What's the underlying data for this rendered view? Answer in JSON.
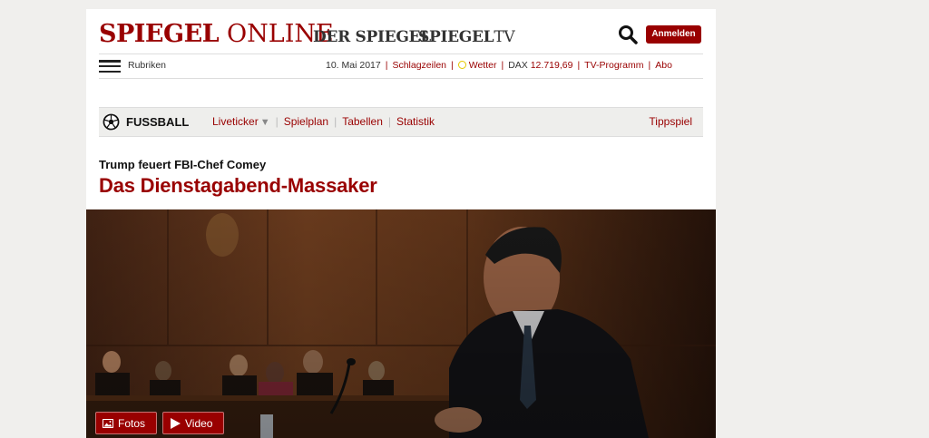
{
  "header": {
    "logo_spiegel": "SPIEGEL",
    "logo_online": "ONLINE",
    "logo_der_spiegel": "DER SPIEGEL",
    "logo_spiegel_tv_main": "SPIEGEL",
    "logo_spiegel_tv_suffix": "TV",
    "login_label": "Anmelden"
  },
  "nav": {
    "rubriken_label": "Rubriken",
    "date": "10. Mai 2017",
    "schlagzeilen": "Schlagzeilen",
    "wetter": "Wetter",
    "dax_label": "DAX",
    "dax_value": "12.719,69",
    "tv_programm": "TV-Programm",
    "abo": "Abo"
  },
  "section": {
    "title": "FUSSBALL",
    "items": [
      "Liveticker",
      "Spielplan",
      "Tabellen",
      "Statistik"
    ],
    "right_link": "Tippspiel"
  },
  "article": {
    "kicker": "Trump feuert FBI-Chef Comey",
    "headline": "Das Dienstagabend-Massaker"
  },
  "media_buttons": {
    "photos_label": "Fotos",
    "video_label": "Video"
  },
  "colors": {
    "brand": "#990000",
    "background": "#f0efed"
  }
}
